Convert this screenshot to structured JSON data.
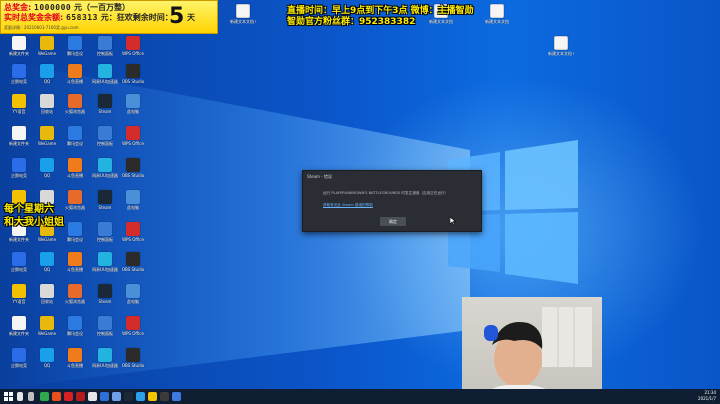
{
  "banner": {
    "line1_prefix": "总奖金:",
    "line1_amount": "1000000",
    "line1_suffix": "元（一百万整）",
    "line2_prefix": "实时总奖金余额:",
    "line2_amount": "658313",
    "line2_suffix": "元：狂欢剩余时间：",
    "line3": "奖励详情：20210601-7100奖.gyu.com",
    "days": "5",
    "days_unit": "天"
  },
  "stream_info": {
    "line1": "直播时间：早上9点到下午3点  微博：主播智勋",
    "line2": "智勋官方粉丝群：952383382"
  },
  "side_text": {
    "line1": "每个星期六",
    "line2": "和大我小姐姐"
  },
  "steam_dialog": {
    "title": "Steam - 错误",
    "message": "运行 PLAYERUNKNOWN'S BATTLEGROUNDS 时发生错误（应用正在运行）",
    "link": "获取有关此 Steam 错误的帮助",
    "ok_button": "确定"
  },
  "desktop_icons": [
    {
      "label": "回收站",
      "color": "#d9d9d9"
    },
    {
      "label": "火狐浏览器",
      "color": "#e86a2a"
    },
    {
      "label": "Steam",
      "color": "#1b2838"
    },
    {
      "label": "此电脑",
      "color": "#4a90d9"
    },
    {
      "label": "新建文件夹",
      "color": "#f5f5f5"
    },
    {
      "label": "WeGame",
      "color": "#e8b90b"
    },
    {
      "label": "腾讯会议",
      "color": "#2a7ae2"
    },
    {
      "label": "控制面板",
      "color": "#3a7bd5"
    },
    {
      "label": "WPS Office",
      "color": "#d42b2b"
    },
    {
      "label": "企鹅电竞",
      "color": "#2b6de8"
    },
    {
      "label": "QQ",
      "color": "#1aa0ea"
    },
    {
      "label": "斗鱼直播",
      "color": "#f07b1a"
    },
    {
      "label": "网易UU加速器",
      "color": "#22b3e0"
    },
    {
      "label": "OBS Studio",
      "color": "#2b2b2b"
    },
    {
      "label": "YY语音",
      "color": "#f2c200"
    }
  ],
  "file_icons": [
    {
      "label": "新建文本文档 (3)"
    },
    {
      "label": "新建文本文档"
    },
    {
      "label": "新建文本文档"
    },
    {
      "label": "新建文本文档 (2)"
    }
  ],
  "tray": {
    "time": "21:34",
    "date": "2021/1/7"
  },
  "colors": {
    "banner_bg": "#ffd400",
    "overlay_text": "#ffee00",
    "dialog_bg": "#2a2d33",
    "taskbar": "#101e33",
    "link": "#66b3ff"
  }
}
